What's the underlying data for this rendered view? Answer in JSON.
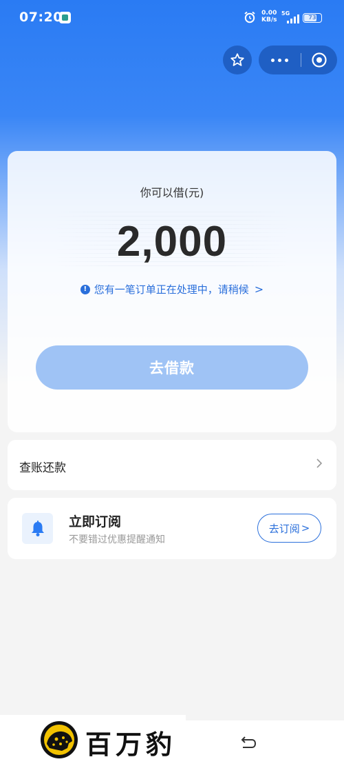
{
  "status_bar": {
    "time": "07:20",
    "net_speed_value": "0.00",
    "net_speed_unit": "KB/s",
    "network": "5G",
    "battery": "73"
  },
  "capsule": {
    "favorite_icon": "star-icon",
    "more_icon": "more-dots-icon",
    "close_icon": "target-close-icon"
  },
  "loan_card": {
    "label": "你可以借(元)",
    "amount": "2,000",
    "notice": "您有一笔订单正在处理中，请稍候",
    "notice_chevron": ">",
    "borrow_button": "去借款"
  },
  "repay": {
    "label": "查账还款"
  },
  "subscribe": {
    "title": "立即订阅",
    "description": "不要错过优惠提醒通知",
    "button": "去订阅",
    "button_chevron": ">"
  },
  "watermark": {
    "text": "百万豹"
  },
  "colors": {
    "brand_blue": "#2a7bf3",
    "link_blue": "#2a6fdb",
    "button_disabled": "#9fc3f5"
  }
}
